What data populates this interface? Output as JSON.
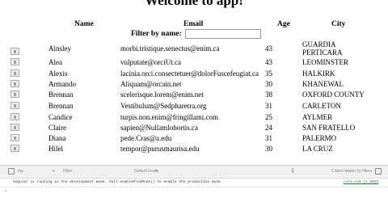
{
  "app": {
    "title": "Welcome to app!"
  },
  "table": {
    "headers": {
      "name": "Name",
      "email": "Email",
      "age": "Age",
      "city": "City"
    },
    "filter": {
      "label": "Filter by name:",
      "value": ""
    },
    "rows": [
      {
        "delete": "x",
        "name": "Ainsley",
        "email": "morbi.tristique.senectus@enim.ca",
        "age": "43",
        "city": "GUARDIA PERTICARA",
        "city_line1": "GUARDIA",
        "city_line2": "PERTICARA"
      },
      {
        "delete": "x",
        "name": "Alea",
        "email": "vulputate@orciUt.ca",
        "age": "43",
        "city": "LEOMINSTER"
      },
      {
        "delete": "x",
        "name": "Alexis",
        "email": "lacinia.orci.consectetuer@dolorFuscefeugiat.ca",
        "age": "35",
        "city": "HALKIRK"
      },
      {
        "delete": "x",
        "name": "Armando",
        "email": "Aliquam@orcain.net",
        "age": "30",
        "city": "KHANEWAL"
      },
      {
        "delete": "x",
        "name": "Brennan",
        "email": "scelerisque.lorem@enim.net",
        "age": "38",
        "city": "OXFORD COUNTY"
      },
      {
        "delete": "x",
        "name": "Brennan",
        "email": "Vestibulum@Sedpharetra.org",
        "age": "31",
        "city": "CARLETON"
      },
      {
        "delete": "x",
        "name": "Candice",
        "email": "turpis.non.enim@fringillami.com",
        "age": "25",
        "city": "AYLMER"
      },
      {
        "delete": "x",
        "name": "Claire",
        "email": "sapien@Nullamlobortis.ca",
        "age": "24",
        "city": "SAN FRATELLO"
      },
      {
        "delete": "x",
        "name": "Diana",
        "email": "pede.Cras@a.edu",
        "age": "31",
        "city": "PALERMO"
      },
      {
        "delete": "x",
        "name": "Hilel",
        "email": "tempor@purusmaurisa.edu",
        "age": "30",
        "city": "LA CRUZ"
      }
    ]
  },
  "devtools": {
    "context_select": "top",
    "filter_placeholder": "Filter",
    "levels_select": "Default levels",
    "hidden_count": "1 item hidden by filters",
    "message": "Angular is running in the development mode. Call enableProdMode() to enable the production mode.",
    "message_source": "core.es5.js:3025"
  }
}
